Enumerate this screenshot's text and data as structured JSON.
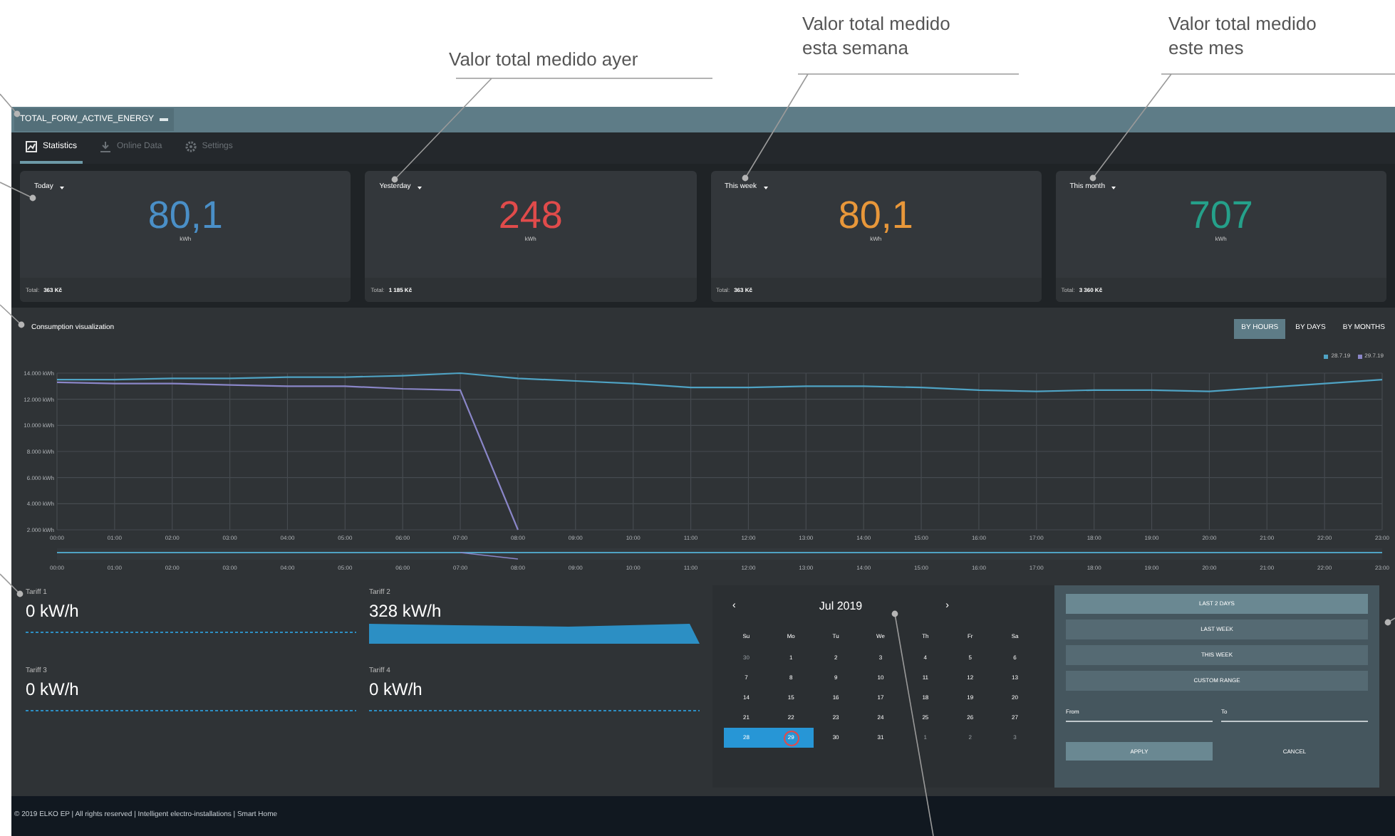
{
  "annotations": [
    {
      "lines": [
        "Valor total medido ayer"
      ]
    },
    {
      "lines": [
        "Valor total medido",
        "esta semana"
      ]
    },
    {
      "lines": [
        "Valor total medido",
        "este mes"
      ]
    }
  ],
  "header": {
    "title": "TOTAL_FORW_ACTIVE_ENERGY"
  },
  "tabs": [
    {
      "label": "Statistics",
      "selected": true,
      "kind": "chart"
    },
    {
      "label": "Online Data",
      "selected": false,
      "kind": "download"
    },
    {
      "label": "Settings",
      "selected": false,
      "kind": "gear"
    }
  ],
  "cards": [
    {
      "period": "Today",
      "value": "80,1",
      "unit": "kWh",
      "total_label": "Total:",
      "total": "363 Kč",
      "color": "#4a8fc7"
    },
    {
      "period": "Yesterday",
      "value": "248",
      "unit": "kWh",
      "total_label": "Total:",
      "total": "1 185 Kč",
      "color": "#e04b4b"
    },
    {
      "period": "This week",
      "value": "80,1",
      "unit": "kWh",
      "total_label": "Total:",
      "total": "363 Kč",
      "color": "#e8973a"
    },
    {
      "period": "This month",
      "value": "707",
      "unit": "kWh",
      "total_label": "Total:",
      "total": "3 360 Kč",
      "color": "#25a08a"
    }
  ],
  "consumption": {
    "title": "Consumption visualization",
    "modes": [
      {
        "label": "BY HOURS",
        "selected": true
      },
      {
        "label": "BY DAYS",
        "selected": false
      },
      {
        "label": "BY MONTHS",
        "selected": false
      }
    ],
    "chart_data": {
      "type": "line",
      "categories": [
        "00:00",
        "01:00",
        "02:00",
        "03:00",
        "04:00",
        "05:00",
        "06:00",
        "07:00",
        "08:00",
        "09:00",
        "10:00",
        "11:00",
        "12:00",
        "13:00",
        "14:00",
        "15:00",
        "16:00",
        "17:00",
        "18:00",
        "19:00",
        "20:00",
        "21:00",
        "22:00",
        "23:00"
      ],
      "ylim": [
        2000,
        14000
      ],
      "grid": true,
      "yticks": [
        {
          "value": 14000,
          "label": "14.000 kWh"
        },
        {
          "value": 12000,
          "label": "12.000 kWh"
        },
        {
          "value": 10000,
          "label": "10.000 kWh"
        },
        {
          "value": 8000,
          "label": "8.000 kWh"
        },
        {
          "value": 6000,
          "label": "6.000 kWh"
        },
        {
          "value": 4000,
          "label": "4.000 kWh"
        },
        {
          "value": 2000,
          "label": "2.000 kWh"
        }
      ],
      "series": [
        {
          "name": "28.7.19",
          "color": "#4fa3c4",
          "values": [
            13500,
            13500,
            13600,
            13600,
            13700,
            13700,
            13800,
            14000,
            13600,
            13400,
            13200,
            12900,
            12900,
            13000,
            13000,
            12900,
            12700,
            12600,
            12700,
            12700,
            12600,
            12900,
            13200,
            13500
          ]
        },
        {
          "name": "29.7.19",
          "color": "#8a86c8",
          "values": [
            13300,
            13200,
            13200,
            13100,
            13000,
            13000,
            12800,
            12700,
            2000,
            null,
            null,
            null,
            null,
            null,
            null,
            null,
            null,
            null,
            null,
            null,
            null,
            null,
            null,
            null
          ]
        }
      ]
    },
    "navigator_labels": [
      "00:00",
      "01:00",
      "02:00",
      "03:00",
      "04:00",
      "05:00",
      "06:00",
      "07:00",
      "08:00",
      "09:00",
      "10:00",
      "11:00",
      "12:00",
      "13:00",
      "14:00",
      "15:00",
      "16:00",
      "17:00",
      "18:00",
      "19:00",
      "20:00",
      "21:00",
      "22:00",
      "23:00"
    ]
  },
  "tariffs": [
    {
      "label": "Tariff 1",
      "value": "0 kW/h",
      "kind": "empty"
    },
    {
      "label": "Tariff 2",
      "value": "328 kW/h",
      "kind": "filled"
    },
    {
      "label": "Tariff 3",
      "value": "0 kW/h",
      "kind": "empty"
    },
    {
      "label": "Tariff 4",
      "value": "0 kW/h",
      "kind": "empty"
    }
  ],
  "calendar": {
    "prev": "‹",
    "month": "Jul 2019",
    "next": "›",
    "weekdays": [
      "Su",
      "Mo",
      "Tu",
      "We",
      "Th",
      "Fr",
      "Sa"
    ],
    "weeks": [
      [
        {
          "day": "30",
          "other_month": true,
          "selected": false,
          "today": false
        },
        {
          "day": "1",
          "other_month": false,
          "selected": false,
          "today": false
        },
        {
          "day": "2",
          "other_month": false,
          "selected": false,
          "today": false
        },
        {
          "day": "3",
          "other_month": false,
          "selected": false,
          "today": false
        },
        {
          "day": "4",
          "other_month": false,
          "selected": false,
          "today": false
        },
        {
          "day": "5",
          "other_month": false,
          "selected": false,
          "today": false
        },
        {
          "day": "6",
          "other_month": false,
          "selected": false,
          "today": false
        }
      ],
      [
        {
          "day": "7",
          "other_month": false,
          "selected": false,
          "today": false
        },
        {
          "day": "8",
          "other_month": false,
          "selected": false,
          "today": false
        },
        {
          "day": "9",
          "other_month": false,
          "selected": false,
          "today": false
        },
        {
          "day": "10",
          "other_month": false,
          "selected": false,
          "today": false
        },
        {
          "day": "11",
          "other_month": false,
          "selected": false,
          "today": false
        },
        {
          "day": "12",
          "other_month": false,
          "selected": false,
          "today": false
        },
        {
          "day": "13",
          "other_month": false,
          "selected": false,
          "today": false
        }
      ],
      [
        {
          "day": "14",
          "other_month": false,
          "selected": false,
          "today": false
        },
        {
          "day": "15",
          "other_month": false,
          "selected": false,
          "today": false
        },
        {
          "day": "16",
          "other_month": false,
          "selected": false,
          "today": false
        },
        {
          "day": "17",
          "other_month": false,
          "selected": false,
          "today": false
        },
        {
          "day": "18",
          "other_month": false,
          "selected": false,
          "today": false
        },
        {
          "day": "19",
          "other_month": false,
          "selected": false,
          "today": false
        },
        {
          "day": "20",
          "other_month": false,
          "selected": false,
          "today": false
        }
      ],
      [
        {
          "day": "21",
          "other_month": false,
          "selected": false,
          "today": false
        },
        {
          "day": "22",
          "other_month": false,
          "selected": false,
          "today": false
        },
        {
          "day": "23",
          "other_month": false,
          "selected": false,
          "today": false
        },
        {
          "day": "24",
          "other_month": false,
          "selected": false,
          "today": false
        },
        {
          "day": "25",
          "other_month": false,
          "selected": false,
          "today": false
        },
        {
          "day": "26",
          "other_month": false,
          "selected": false,
          "today": false
        },
        {
          "day": "27",
          "other_month": false,
          "selected": false,
          "today": false
        }
      ],
      [
        {
          "day": "28",
          "other_month": false,
          "selected": true,
          "today": false
        },
        {
          "day": "29",
          "other_month": false,
          "selected": true,
          "today": true
        },
        {
          "day": "30",
          "other_month": false,
          "selected": false,
          "today": false
        },
        {
          "day": "31",
          "other_month": false,
          "selected": false,
          "today": false
        },
        {
          "day": "1",
          "other_month": true,
          "selected": false,
          "today": false
        },
        {
          "day": "2",
          "other_month": true,
          "selected": false,
          "today": false
        },
        {
          "day": "3",
          "other_month": true,
          "selected": false,
          "today": false
        }
      ]
    ]
  },
  "ranges": {
    "presets": [
      {
        "label": "LAST 2 DAYS",
        "selected": true
      },
      {
        "label": "LAST WEEK",
        "selected": false
      },
      {
        "label": "THIS WEEK",
        "selected": false
      },
      {
        "label": "CUSTOM RANGE",
        "selected": false
      }
    ],
    "from": {
      "placeholder": "From"
    },
    "to": {
      "placeholder": "To"
    },
    "apply": "APPLY",
    "cancel": "CANCEL"
  },
  "footer": "© 2019 ELKO EP | All rights reserved | Intelligent electro-installations | Smart Home"
}
